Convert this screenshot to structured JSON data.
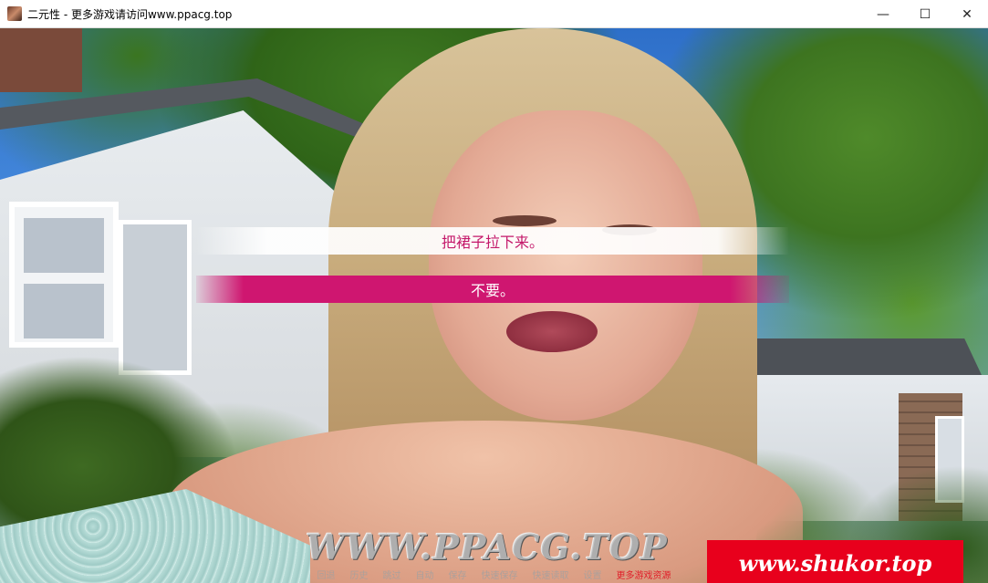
{
  "window": {
    "title": "二元性 - 更多游戏请访问www.ppacg.top",
    "controls": {
      "minimize": "—",
      "maximize": "☐",
      "close": "✕"
    }
  },
  "dialogue": {
    "choices": [
      "把裙子拉下来。",
      "不要。"
    ],
    "hovered_index": 1
  },
  "watermarks": {
    "ppacg": "WWW.PPACG.TOP",
    "shukor": "www.shukor.top"
  },
  "quick_menu": {
    "items": [
      "回退",
      "历史",
      "跳过",
      "自动",
      "保存",
      "快速保存",
      "快速读取",
      "设置",
      "更多游戏资源"
    ]
  },
  "colors": {
    "choice_accent": "#cf1670",
    "choice_text": "#c4186a",
    "watermark_red": "#e8001c"
  }
}
